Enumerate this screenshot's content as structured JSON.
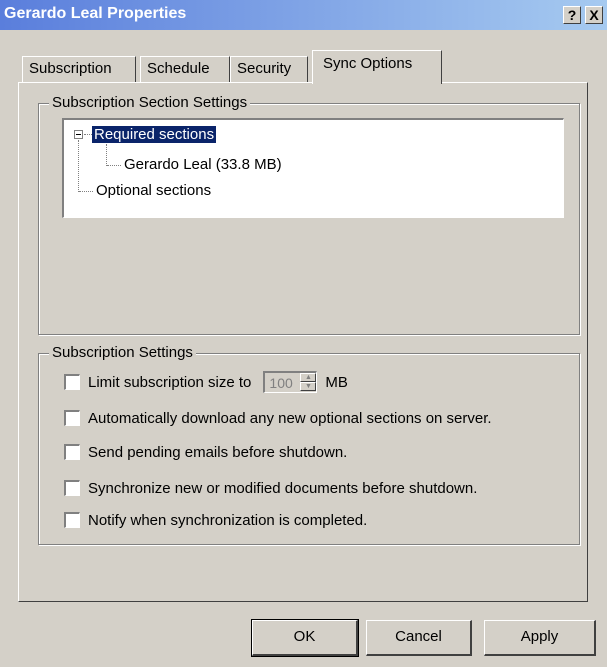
{
  "window": {
    "title": "Gerardo Leal Properties",
    "help_button": "?",
    "close_button": "X"
  },
  "tabs": [
    {
      "label": "Subscription",
      "active": false
    },
    {
      "label": "Schedule",
      "active": false
    },
    {
      "label": "Security",
      "active": false
    },
    {
      "label": "Sync Options",
      "active": true
    }
  ],
  "section_settings": {
    "legend": "Subscription Section Settings",
    "tree": {
      "required": {
        "label": "Required sections",
        "expanded": true,
        "selected": true
      },
      "required_child": {
        "label": "Gerardo Leal (33.8 MB)"
      },
      "optional": {
        "label": "Optional sections"
      }
    }
  },
  "subscription_settings": {
    "legend": "Subscription Settings",
    "limit_size": {
      "label": "Limit subscription size to",
      "checked": false,
      "value": "100",
      "unit": "MB"
    },
    "auto_download": {
      "label": "Automatically download any new optional sections on server.",
      "checked": false
    },
    "send_pending": {
      "label": "Send pending emails before shutdown.",
      "checked": false
    },
    "sync_new": {
      "label": "Synchronize new or modified documents before shutdown.",
      "checked": false
    },
    "notify": {
      "label": "Notify when synchronization is completed.",
      "checked": false
    }
  },
  "buttons": {
    "ok": "OK",
    "cancel": "Cancel",
    "apply": "Apply"
  }
}
